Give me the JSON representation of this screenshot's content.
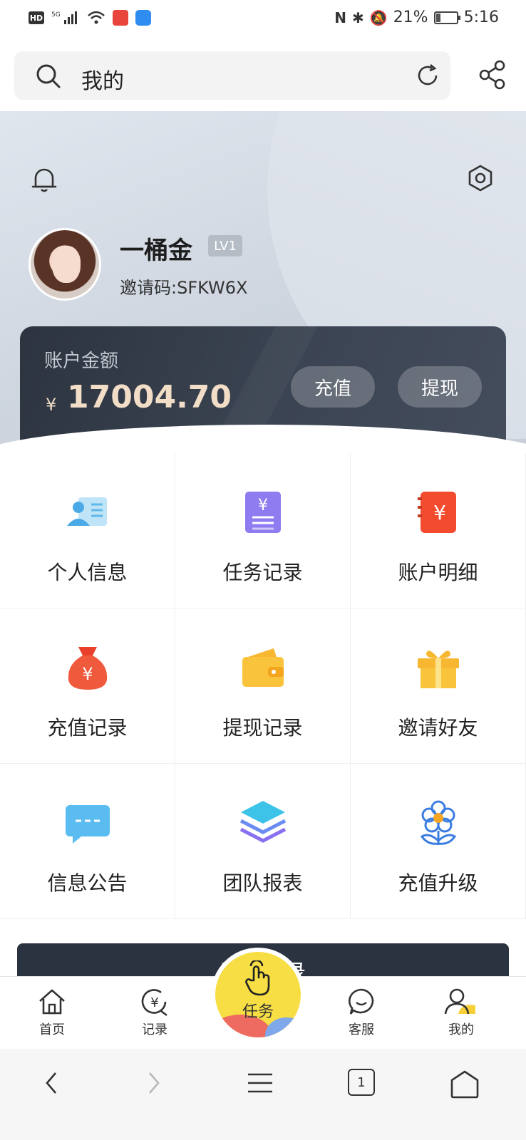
{
  "status_bar": {
    "hd": "HD",
    "network": "5G",
    "battery_percent": "21%",
    "battery_level": 0.21,
    "time": "5:16"
  },
  "browser": {
    "address_text": "我的"
  },
  "profile": {
    "username": "一桶金",
    "level": "LV1",
    "invite_code": "邀请码:SFKW6X"
  },
  "balance": {
    "label": "账户金额",
    "currency": "¥",
    "amount": "17004.70",
    "recharge_label": "充值",
    "withdraw_label": "提现"
  },
  "menu": {
    "items": [
      {
        "label": "个人信息",
        "icon": "id-card-icon"
      },
      {
        "label": "任务记录",
        "icon": "task-record-icon"
      },
      {
        "label": "账户明细",
        "icon": "account-detail-icon"
      },
      {
        "label": "充值记录",
        "icon": "money-bag-icon"
      },
      {
        "label": "提现记录",
        "icon": "wallet-icon"
      },
      {
        "label": "邀请好友",
        "icon": "gift-icon"
      },
      {
        "label": "信息公告",
        "icon": "message-icon"
      },
      {
        "label": "团队报表",
        "icon": "layers-icon"
      },
      {
        "label": "充值升级",
        "icon": "flower-icon"
      }
    ]
  },
  "logout": {
    "label": "退出登录"
  },
  "tabbar": {
    "home": "首页",
    "record": "记录",
    "task": "任务",
    "service": "客服",
    "me": "我的"
  },
  "navbar": {
    "tab_count": "1"
  },
  "colors": {
    "card_dark": "#2d3440",
    "amount_gold": "#f2ddc7",
    "task_yellow": "#f7de44"
  }
}
